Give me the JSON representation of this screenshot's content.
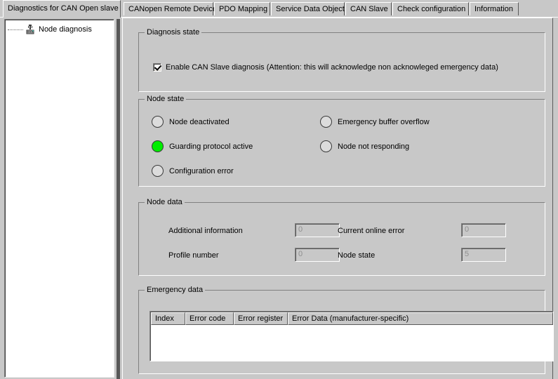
{
  "window": {
    "title": "Diagnostics for CAN Open slave",
    "bg_color": "#c8c8c8"
  },
  "tabs": [
    {
      "label": "Diagnostics for CAN Open slave",
      "active": true
    },
    {
      "label": "CANopen Remote Device",
      "active": false
    },
    {
      "label": "PDO Mapping",
      "active": false
    },
    {
      "label": "Service Data Object",
      "active": false
    },
    {
      "label": "CAN Slave",
      "active": false
    },
    {
      "label": "Check configuration",
      "active": false
    },
    {
      "label": "Information",
      "active": false
    }
  ],
  "tree": {
    "items": [
      {
        "label": "Node diagnosis",
        "icon": "network-node-icon"
      }
    ]
  },
  "diagnosis_state": {
    "title": "Diagnosis state",
    "checkbox": {
      "label": "Enable CAN Slave diagnosis (Attention: this will acknowledge non acknowleged emergency data)",
      "checked": true
    }
  },
  "node_state": {
    "title": "Node state",
    "on_color": "#00ee00",
    "off_color": "#dcdcdc",
    "indicators": [
      {
        "label": "Node deactivated",
        "on": false
      },
      {
        "label": "Guarding protocol active",
        "on": true
      },
      {
        "label": "Configuration error",
        "on": false
      },
      {
        "label": "Emergency buffer overflow",
        "on": false
      },
      {
        "label": "Node not responding",
        "on": false
      }
    ]
  },
  "node_data": {
    "title": "Node data",
    "fields": [
      {
        "label": "Additional information",
        "value": "0",
        "enabled": false
      },
      {
        "label": "Current online error",
        "value": "0",
        "enabled": false
      },
      {
        "label": "Profile number",
        "value": "0",
        "enabled": false
      },
      {
        "label": "Node state",
        "value": "5",
        "enabled": false
      }
    ]
  },
  "emergency_data": {
    "title": "Emergency data",
    "columns": [
      "Index",
      "Error code",
      "Error register",
      "Error Data (manufacturer-specific)"
    ],
    "rows": []
  }
}
